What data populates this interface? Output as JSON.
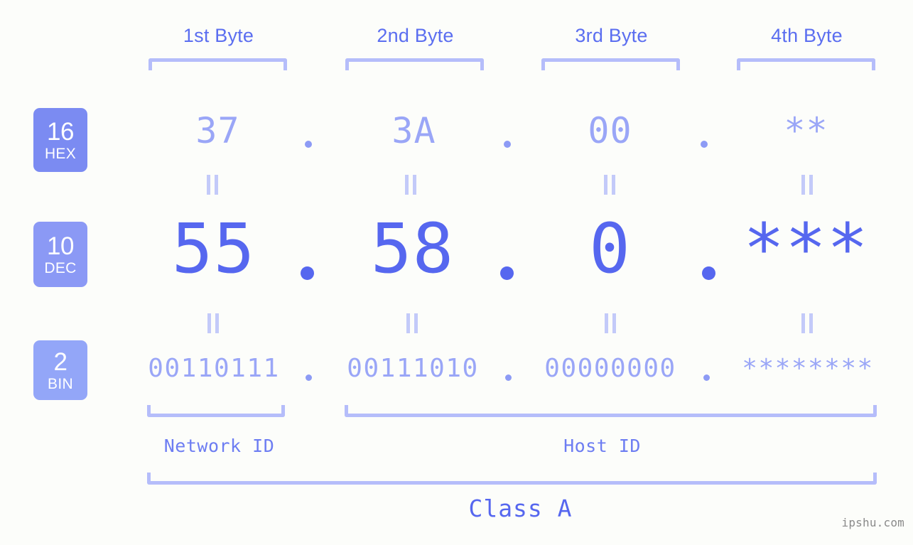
{
  "background_color": "#fcfdfa",
  "accent_color": "#5667ef",
  "accent_light_color": "#9aa6f7",
  "bracket_color": "#b5bdfa",
  "header": {
    "bytes": [
      {
        "label": "1st Byte"
      },
      {
        "label": "2nd Byte"
      },
      {
        "label": "3rd Byte"
      },
      {
        "label": "4th Byte"
      }
    ]
  },
  "rows": [
    {
      "key": "hex",
      "badge_number": "16",
      "badge_abbr": "HEX",
      "badge_color": "#7b8bf2",
      "values": [
        "37",
        "3A",
        "00",
        "**"
      ],
      "separator": "."
    },
    {
      "key": "dec",
      "badge_number": "10",
      "badge_abbr": "DEC",
      "badge_color": "#8b99f5",
      "values": [
        "55",
        "58",
        "0",
        "***"
      ],
      "separator": "."
    },
    {
      "key": "bin",
      "badge_number": "2",
      "badge_abbr": "BIN",
      "badge_color": "#93a6f8",
      "values": [
        "00110111",
        "00111010",
        "00000000",
        "********"
      ],
      "separator": "."
    }
  ],
  "equality_marks": {
    "symbol": "||",
    "count_per_row": 4
  },
  "footer": {
    "network_id_label": "Network ID",
    "host_id_label": "Host ID",
    "class_label": "Class A"
  },
  "watermark": "ipshu.com"
}
